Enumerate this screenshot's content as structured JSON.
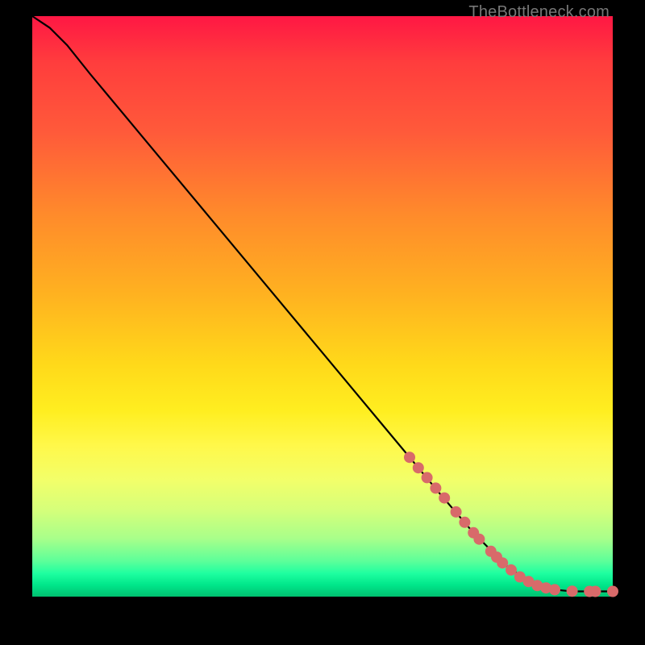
{
  "watermark": "TheBottleneck.com",
  "chart_data": {
    "type": "line",
    "title": "",
    "xlabel": "",
    "ylabel": "",
    "xlim": [
      0,
      100
    ],
    "ylim": [
      0,
      100
    ],
    "grid": false,
    "legend": false,
    "series": [
      {
        "name": "curve",
        "color": "#000000",
        "x": [
          0,
          3,
          6,
          10,
          15,
          20,
          30,
          40,
          50,
          60,
          70,
          76,
          82,
          86,
          88,
          90,
          92,
          94,
          96,
          98,
          100
        ],
        "y": [
          100,
          98,
          95,
          90,
          84,
          78,
          66,
          54,
          42,
          30,
          18,
          11,
          5,
          2.5,
          1.6,
          1.2,
          1.0,
          0.9,
          0.9,
          0.9,
          0.9
        ]
      }
    ],
    "markers": {
      "name": "highlighted-points",
      "color": "#d86a6a",
      "radius_px": 7,
      "points": [
        {
          "x": 65,
          "y": 24
        },
        {
          "x": 66.5,
          "y": 22.2
        },
        {
          "x": 68,
          "y": 20.5
        },
        {
          "x": 69.5,
          "y": 18.7
        },
        {
          "x": 71,
          "y": 17
        },
        {
          "x": 73,
          "y": 14.6
        },
        {
          "x": 74.5,
          "y": 12.8
        },
        {
          "x": 76,
          "y": 11
        },
        {
          "x": 77,
          "y": 9.9
        },
        {
          "x": 79,
          "y": 7.8
        },
        {
          "x": 80,
          "y": 6.8
        },
        {
          "x": 81,
          "y": 5.8
        },
        {
          "x": 82.5,
          "y": 4.6
        },
        {
          "x": 84,
          "y": 3.4
        },
        {
          "x": 85.5,
          "y": 2.6
        },
        {
          "x": 87,
          "y": 1.9
        },
        {
          "x": 88.5,
          "y": 1.5
        },
        {
          "x": 90,
          "y": 1.2
        },
        {
          "x": 93,
          "y": 0.95
        },
        {
          "x": 96,
          "y": 0.9
        },
        {
          "x": 97,
          "y": 0.9
        },
        {
          "x": 100,
          "y": 0.9
        }
      ]
    }
  }
}
